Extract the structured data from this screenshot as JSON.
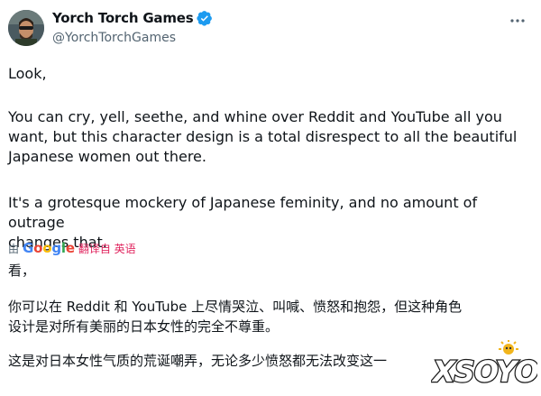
{
  "header": {
    "display_name": "Yorch Torch Games",
    "handle": "@YorchTorchGames"
  },
  "tweet": {
    "para1": "Look,",
    "para2_line1": "You can cry, yell, seethe, and whine over Reddit and YouTube all you",
    "para2_line2": "want, but this character design is a total disrespect to all the beautiful",
    "para2_line3": "Japanese women out there.",
    "para3_line1": "It's a grotesque mockery of Japanese feminity, and no amount of outrage",
    "para3_line2": "changes that."
  },
  "translation": {
    "by_label": "由",
    "google_g1": "G",
    "google_o1": "o",
    "google_o2": "o",
    "google_g2": "g",
    "google_l": "l",
    "google_e": "e",
    "translated_label": "翻译自 英语",
    "line1": "看，",
    "line2": "你可以在 Reddit 和 YouTube 上尽情哭泣、叫喊、愤怒和抱怨，但这种角色",
    "line3": "设计是对所有美丽的日本女性的完全不尊重。",
    "line4": "这是对日本女性气质的荒诞嘲弄，无论多少愤怒都无法改变这一"
  },
  "watermark": {
    "text": "XSOYO"
  },
  "colors": {
    "verified": "#1d9bf0",
    "translated": "#e0245e",
    "handle": "#536471"
  },
  "icons": {
    "verified": "verified-badge-icon",
    "more": "more-options-icon"
  }
}
